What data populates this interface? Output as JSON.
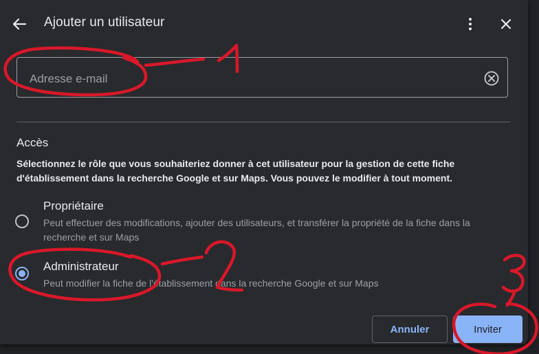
{
  "dialog": {
    "title": "Ajouter un utilisateur",
    "icons": {
      "back": "arrow-back-icon",
      "more": "more-vert-icon",
      "close": "close-icon"
    }
  },
  "email": {
    "placeholder": "Adresse e-mail",
    "value": "",
    "clear_icon": "clear-circle-icon"
  },
  "access": {
    "title": "Accès",
    "description": "Sélectionnez le rôle que vous souhaiteriez donner à cet utilisateur pour la gestion de cette fiche d'établissement dans la recherche Google et sur Maps. Vous pouvez le modifier à tout moment.",
    "roles": [
      {
        "name": "Propriétaire",
        "description": "Peut effectuer des modifications, ajouter des utilisateurs, et transférer la propriété de la fiche dans la recherche et sur Maps",
        "selected": false
      },
      {
        "name": "Administrateur",
        "description": "Peut modifier la fiche de l'établissement dans la recherche Google et sur Maps",
        "selected": true
      }
    ]
  },
  "actions": {
    "cancel_label": "Annuler",
    "invite_label": "Inviter"
  },
  "annotations": {
    "labels": [
      "1",
      "2",
      "3"
    ],
    "color": "#d9182a"
  },
  "colors": {
    "dialog_background": "#292a2d",
    "accent": "#8ab4f8",
    "text_primary": "#e8eaed",
    "text_secondary": "#9aa0a6"
  }
}
